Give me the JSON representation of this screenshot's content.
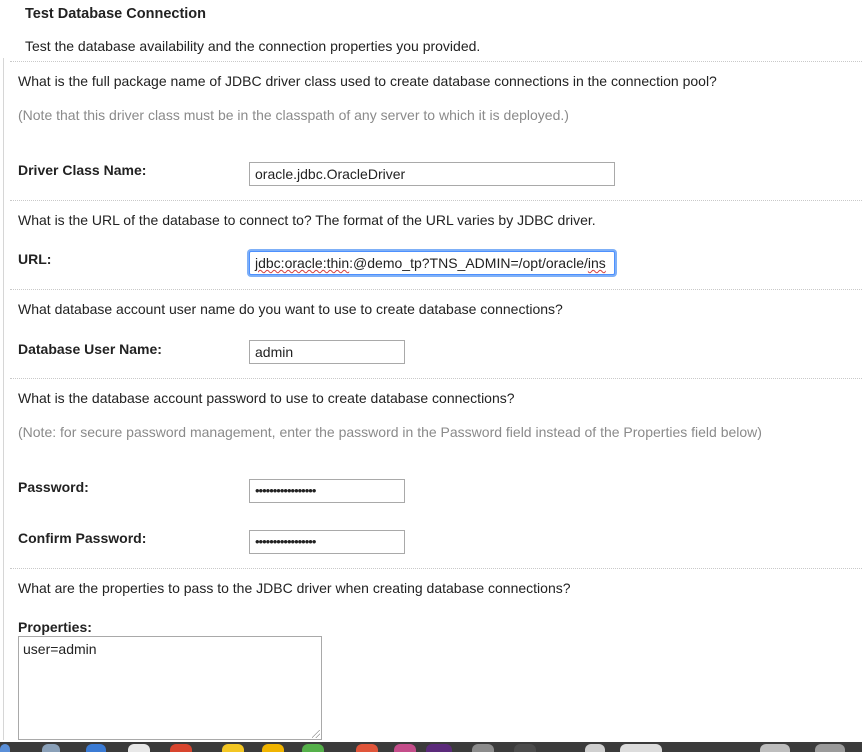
{
  "title": "Test Database Connection",
  "subtitle": "Test the database availability and the connection properties you provided.",
  "driver": {
    "question": "What is the full package name of JDBC driver class used to create database connections in the connection pool?",
    "note": "(Note that this driver class must be in the classpath of any server to which it is deployed.)",
    "label": "Driver Class Name:",
    "value": "oracle.jdbc.OracleDriver"
  },
  "url": {
    "question": "What is the URL of the database to connect to? The format of the URL varies by JDBC driver.",
    "label": "URL:",
    "value_underlined": "jdbc:oracle:thin",
    "value_rest": ":@demo_tp?TNS_ADMIN=/opt/oracle/",
    "value_tail": "ins"
  },
  "user": {
    "question": "What database account user name do you want to use to create database connections?",
    "label": "Database User Name:",
    "value": "admin"
  },
  "password": {
    "question": "What is the database account password to use to create database connections?",
    "note": "(Note: for secure password management, enter the password in the Password field instead of the Properties field below)",
    "label": "Password:",
    "masked": "•••••••••••••••••",
    "confirm_label": "Confirm Password:",
    "confirm_masked": "•••••••••••••••••"
  },
  "properties": {
    "question": "What are the properties to pass to the JDBC driver when creating database connections?",
    "label": "Properties:",
    "value": "user=admin"
  }
}
